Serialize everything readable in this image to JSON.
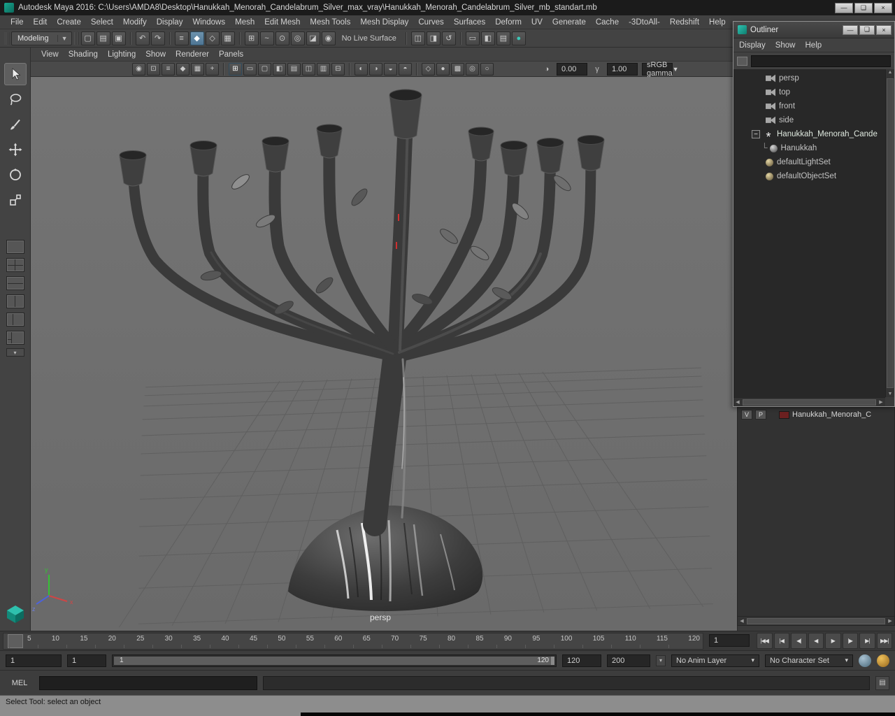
{
  "window": {
    "title": "Autodesk Maya 2016: C:\\Users\\AMDA8\\Desktop\\Hanukkah_Menorah_Candelabrum_Silver_max_vray\\Hanukkah_Menorah_Candelabrum_Silver_mb_standart.mb",
    "controls": {
      "minimize": "—",
      "maximize": "❏",
      "close": "×"
    }
  },
  "menubar": {
    "items": [
      "File",
      "Edit",
      "Create",
      "Select",
      "Modify",
      "Display",
      "Windows",
      "Mesh",
      "Edit Mesh",
      "Mesh Tools",
      "Mesh Display",
      "Curves",
      "Surfaces",
      "Deform",
      "UV",
      "Generate",
      "Cache",
      "-3DtoAll-",
      "Redshift",
      "Help"
    ]
  },
  "status": {
    "modeling": "Modeling",
    "no_live_surface": "No Live Surface",
    "files": [
      {
        "name": "new-scene-icon",
        "glyph": "▢",
        "cls": ""
      },
      {
        "name": "open-scene-icon",
        "glyph": "▤",
        "cls": ""
      },
      {
        "name": "save-scene-icon",
        "glyph": "▣",
        "cls": ""
      }
    ],
    "edit": [
      {
        "name": "undo-icon",
        "glyph": "↶",
        "cls": ""
      },
      {
        "name": "redo-icon",
        "glyph": "↷",
        "cls": ""
      }
    ],
    "selection": [
      {
        "name": "select-hierarchy-icon",
        "glyph": "≡",
        "cls": ""
      },
      {
        "name": "select-object-icon",
        "glyph": "◆",
        "cls": "active"
      },
      {
        "name": "select-component-icon",
        "glyph": "◇",
        "cls": ""
      },
      {
        "name": "selection-mask-icon",
        "glyph": "▦",
        "cls": ""
      }
    ],
    "snap": [
      {
        "name": "snap-grid-icon",
        "glyph": "⊞",
        "cls": ""
      },
      {
        "name": "snap-curve-icon",
        "glyph": "~",
        "cls": ""
      },
      {
        "name": "snap-point-icon",
        "glyph": "⊙",
        "cls": ""
      },
      {
        "name": "snap-projected-center-icon",
        "glyph": "◎",
        "cls": ""
      },
      {
        "name": "snap-plane-icon",
        "glyph": "◪",
        "cls": ""
      },
      {
        "name": "make-live-icon",
        "glyph": "◉",
        "cls": ""
      }
    ],
    "history": [
      {
        "name": "input-connections-icon",
        "glyph": "◫",
        "cls": ""
      },
      {
        "name": "output-connections-icon",
        "glyph": "◨",
        "cls": ""
      },
      {
        "name": "construction-history-icon",
        "glyph": "↺",
        "cls": ""
      }
    ],
    "render": [
      {
        "name": "render-view-icon",
        "glyph": "▭",
        "cls": ""
      },
      {
        "name": "ipr-render-icon",
        "glyph": "◧",
        "cls": ""
      },
      {
        "name": "render-settings-icon",
        "glyph": "▤",
        "cls": ""
      },
      {
        "name": "display-render-icon",
        "glyph": "●",
        "cls": "teal"
      }
    ]
  },
  "panel_menu": {
    "items": [
      "View",
      "Shading",
      "Lighting",
      "Show",
      "Renderer",
      "Panels"
    ]
  },
  "viewbar": {
    "g1": [
      {
        "name": "select-camera-icon",
        "glyph": "◉",
        "cls": ""
      },
      {
        "name": "lock-camera-icon",
        "glyph": "⊡",
        "cls": ""
      },
      {
        "name": "camera-attributes-icon",
        "glyph": "≡",
        "cls": ""
      },
      {
        "name": "bookmark-icon",
        "glyph": "◆",
        "cls": ""
      },
      {
        "name": "image-plane-icon",
        "glyph": "▦",
        "cls": ""
      },
      {
        "name": "pan-zoom-icon",
        "glyph": "+",
        "cls": ""
      }
    ],
    "g2": [
      {
        "name": "grid-icon",
        "glyph": "⊞",
        "cls": "active"
      },
      {
        "name": "film-gate-icon",
        "glyph": "▭",
        "cls": ""
      },
      {
        "name": "resolution-gate-icon",
        "glyph": "▢",
        "cls": ""
      },
      {
        "name": "gate-mask-icon",
        "glyph": "◧",
        "cls": ""
      },
      {
        "name": "field-chart-icon",
        "glyph": "▤",
        "cls": ""
      },
      {
        "name": "safe-action-icon",
        "glyph": "◫",
        "cls": ""
      },
      {
        "name": "safe-title-icon",
        "glyph": "▥",
        "cls": ""
      },
      {
        "name": "frame-all-icon",
        "glyph": "⊟",
        "cls": ""
      }
    ],
    "g3": [
      {
        "name": "default-light-icon",
        "glyph": "◐",
        "cls": ""
      },
      {
        "name": "all-lights-icon",
        "glyph": "◑",
        "cls": ""
      },
      {
        "name": "shadows-icon",
        "glyph": "◒",
        "cls": ""
      },
      {
        "name": "ambient-occlusion-icon",
        "glyph": "◓",
        "cls": ""
      }
    ],
    "g4": [
      {
        "name": "wireframe-icon",
        "glyph": "◇",
        "cls": ""
      },
      {
        "name": "shaded-icon",
        "glyph": "●",
        "cls": ""
      },
      {
        "name": "textured-icon",
        "glyph": "▩",
        "cls": ""
      },
      {
        "name": "xray-icon",
        "glyph": "◎",
        "cls": ""
      },
      {
        "name": "isolate-select-icon",
        "glyph": "○",
        "cls": ""
      }
    ],
    "exposure": "0.00",
    "gamma": "1.00",
    "view_transform": "sRGB gamma"
  },
  "viewport": {
    "camera_label": "persp"
  },
  "toolbox": {
    "tools": [
      "select-tool",
      "lasso-tool",
      "paint-select-tool",
      "move-tool",
      "rotate-tool",
      "scale-tool"
    ],
    "layouts": [
      "layout-single-pane",
      "layout-four-pane",
      "layout-two-pane-stacked",
      "layout-two-pane-side",
      "layout-three-pane",
      "layout-outliner-persp"
    ]
  },
  "outliner": {
    "title": "Outliner",
    "controls": {
      "minimize": "—",
      "maximize": "❏",
      "close": "×"
    },
    "menus": [
      "Display",
      "Show",
      "Help"
    ],
    "items": [
      {
        "label": "persp",
        "cls": "t-camera d1",
        "toggle": "",
        "conn": ""
      },
      {
        "label": "top",
        "cls": "t-camera d1",
        "toggle": "",
        "conn": ""
      },
      {
        "label": "front",
        "cls": "t-camera d1",
        "toggle": "",
        "conn": ""
      },
      {
        "label": "side",
        "cls": "t-camera d1",
        "toggle": "",
        "conn": ""
      },
      {
        "label": "Hanukkah_Menorah_Cande",
        "cls": "t-transform d0 has-toggle hl",
        "toggle": "−",
        "conn": ""
      },
      {
        "label": "Hanukkah",
        "cls": "t-mesh d2 child",
        "toggle": "",
        "conn": "└"
      },
      {
        "label": "defaultLightSet",
        "cls": "t-set d1",
        "toggle": "",
        "conn": ""
      },
      {
        "label": "defaultObjectSet",
        "cls": "t-set d1",
        "toggle": "",
        "conn": ""
      }
    ]
  },
  "layer_editor": {
    "visibility_label": "V",
    "playback_label": "P",
    "layers": [
      {
        "name": "Hanukkah_Menorah_C",
        "color": "#6b2020"
      }
    ]
  },
  "timeline": {
    "ticks": [
      "5",
      "10",
      "15",
      "20",
      "25",
      "30",
      "35",
      "40",
      "45",
      "50",
      "55",
      "60",
      "65",
      "70",
      "75",
      "80",
      "85",
      "90",
      "95",
      "100",
      "105",
      "110",
      "115",
      "120"
    ],
    "current_frame": "1",
    "playback": [
      {
        "name": "go-to-start-button",
        "glyph": "|◀◀"
      },
      {
        "name": "step-back-key-button",
        "glyph": "|◀"
      },
      {
        "name": "step-back-frame-button",
        "glyph": "◀|"
      },
      {
        "name": "play-backwards-button",
        "glyph": "◀"
      },
      {
        "name": "play-forwards-button",
        "glyph": "▶"
      },
      {
        "name": "step-forward-frame-button",
        "glyph": "|▶"
      },
      {
        "name": "step-forward-key-button",
        "glyph": "▶|"
      },
      {
        "name": "go-to-end-button",
        "glyph": "▶▶|"
      }
    ]
  },
  "range": {
    "anim_start": "1",
    "playback_start": "1",
    "bar_start": "1",
    "bar_end": "120",
    "playback_end": "120",
    "anim_end": "200",
    "anim_layer": "No Anim Layer",
    "character_set": "No Character Set",
    "dropdown_glyph": "▾"
  },
  "command_line": {
    "label": "MEL"
  },
  "help_line": {
    "text": "Select Tool: select an object"
  }
}
